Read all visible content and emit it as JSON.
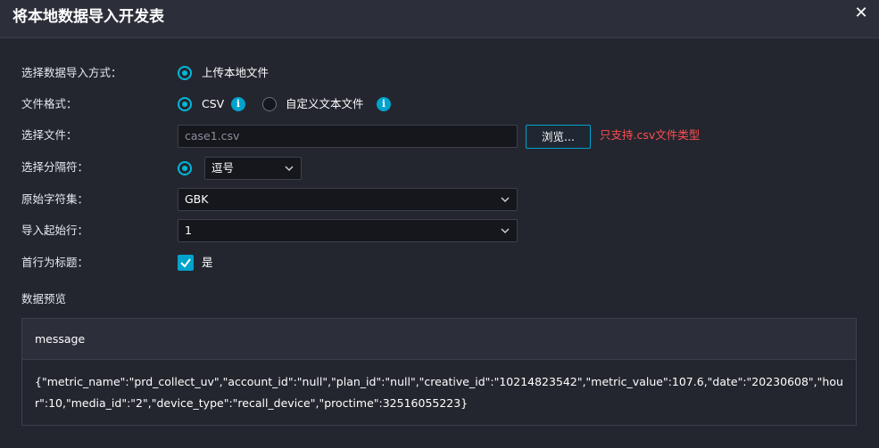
{
  "dialog": {
    "title": "将本地数据导入开发表",
    "close_glyph": "✕"
  },
  "form": {
    "import_method": {
      "label": "选择数据导入方式：",
      "option": "上传本地文件"
    },
    "file_format": {
      "label": "文件格式：",
      "options": [
        "CSV",
        "自定义文本文件"
      ],
      "info_glyph": "i"
    },
    "file": {
      "label": "选择文件：",
      "placeholder": "case1.csv",
      "browse_label": "浏览...",
      "hint": "只支持.csv文件类型"
    },
    "delimiter": {
      "label": "选择分隔符：",
      "selected": "逗号"
    },
    "charset": {
      "label": "原始字符集：",
      "selected": "GBK"
    },
    "start_row": {
      "label": "导入起始行：",
      "selected": "1"
    },
    "header_row": {
      "label": "首行为标题：",
      "checkbox_label": "是"
    }
  },
  "preview": {
    "title": "数据预览",
    "columns": [
      "message"
    ],
    "rows": [
      [
        "{\"metric_name\":\"prd_collect_uv\",\"account_id\":\"null\",\"plan_id\":\"null\",\"creative_id\":\"10214823542\",\"metric_value\":107.6,\"date\":\"20230608\",\"hour\":10,\"media_id\":\"2\",\"device_type\":\"recall_device\",\"proctime\":32516055223}"
      ]
    ]
  },
  "colors": {
    "accent": "#00a3cc",
    "error": "#ff4d4f",
    "background": "#24262f"
  }
}
